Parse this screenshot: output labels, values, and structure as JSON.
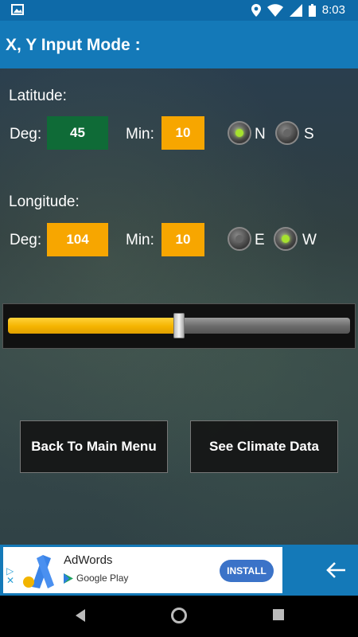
{
  "status_bar": {
    "time": "8:03",
    "icons": [
      "image-icon",
      "location-icon",
      "wifi-icon",
      "signal-icon",
      "battery-icon"
    ]
  },
  "header": {
    "title": "X, Y Input Mode :"
  },
  "latitude": {
    "label": "Latitude:",
    "deg_label": "Deg:",
    "deg_value": "45",
    "min_label": "Min:",
    "min_value": "10",
    "options": [
      {
        "label": "N",
        "selected": true
      },
      {
        "label": "S",
        "selected": false
      }
    ]
  },
  "longitude": {
    "label": "Longitude:",
    "deg_label": "Deg:",
    "deg_value": "104",
    "min_label": "Min:",
    "min_value": "10",
    "options": [
      {
        "label": "E",
        "selected": false
      },
      {
        "label": "W",
        "selected": true
      }
    ]
  },
  "slider": {
    "value_fraction": 0.5
  },
  "buttons": {
    "back": "Back To Main Menu",
    "climate": "See Climate Data"
  },
  "ad": {
    "app_name": "AdWords",
    "store": "Google Play",
    "install_label": "INSTALL"
  },
  "colors": {
    "title_bar": "#1479b8",
    "status_bar": "#0e6aa8",
    "value_box": "#f7a600",
    "active_value_box": "#0f6b37",
    "radio_on": "#a6e22e"
  }
}
